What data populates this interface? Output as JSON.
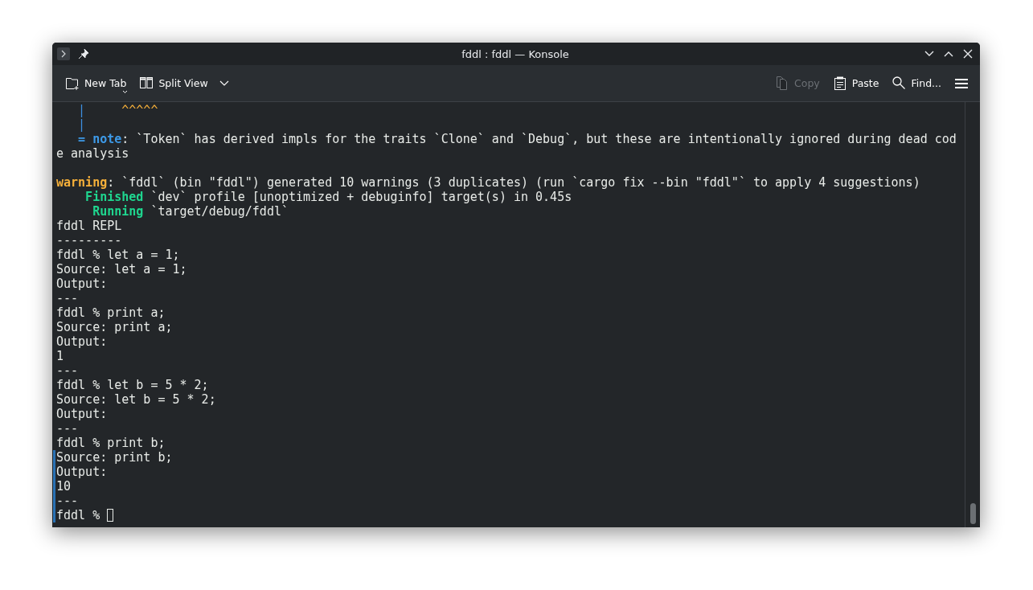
{
  "window": {
    "title": "fddl : fddl — Konsole"
  },
  "toolbar": {
    "left": [
      {
        "label": "New Tab",
        "kind": "newtab",
        "disabled": false
      },
      {
        "label": "Split View",
        "kind": "split",
        "disabled": false
      }
    ],
    "right": [
      {
        "label": "Copy",
        "kind": "copy",
        "disabled": true
      },
      {
        "label": "Paste",
        "kind": "paste",
        "disabled": false
      },
      {
        "label": "Find...",
        "kind": "find",
        "disabled": false
      }
    ]
  },
  "terminal": {
    "lines": [
      {
        "marked": false,
        "segments": [
          {
            "text": "   |",
            "kind": "gutter"
          },
          {
            "text": "     ^^^^^",
            "kind": "caret"
          }
        ]
      },
      {
        "marked": false,
        "segments": [
          {
            "text": "   |",
            "kind": "gutter"
          }
        ]
      },
      {
        "marked": false,
        "segments": [
          {
            "text": "   = note",
            "kind": "note"
          },
          {
            "text": ": `Token` has derived impls for the traits `Clone` and `Debug`, but these are intentionally ignored during dead cod",
            "kind": "plain"
          }
        ]
      },
      {
        "marked": false,
        "segments": [
          {
            "text": "e analysis",
            "kind": "plain"
          }
        ]
      },
      {
        "marked": false
      },
      {
        "marked": false,
        "segments": [
          {
            "text": "warning",
            "kind": "warning"
          },
          {
            "text": ": `fddl` (bin \"fddl\") generated 10 warnings (3 duplicates) (run `cargo fix --bin \"fddl\"` to apply 4 suggestions)",
            "kind": "plain"
          }
        ]
      },
      {
        "marked": false,
        "segments": [
          {
            "text": "    Finished",
            "kind": "status"
          },
          {
            "text": " `dev` profile [unoptimized + debuginfo] target(s) in 0.45s",
            "kind": "plain"
          }
        ]
      },
      {
        "marked": false,
        "segments": [
          {
            "text": "     Running",
            "kind": "status"
          },
          {
            "text": " `target/debug/fddl`",
            "kind": "plain"
          }
        ]
      },
      {
        "marked": false,
        "segments": [
          {
            "text": "fddl REPL",
            "kind": "plain"
          }
        ]
      },
      {
        "marked": false,
        "segments": [
          {
            "text": "---------",
            "kind": "plain"
          }
        ]
      },
      {
        "marked": false,
        "segments": [
          {
            "text": "fddl % let a = 1;",
            "kind": "plain"
          }
        ]
      },
      {
        "marked": false,
        "segments": [
          {
            "text": "Source: let a = 1;",
            "kind": "plain"
          }
        ]
      },
      {
        "marked": false,
        "segments": [
          {
            "text": "Output:",
            "kind": "plain"
          }
        ]
      },
      {
        "marked": false,
        "segments": [
          {
            "text": "---",
            "kind": "plain"
          }
        ]
      },
      {
        "marked": false,
        "segments": [
          {
            "text": "fddl % print a;",
            "kind": "plain"
          }
        ]
      },
      {
        "marked": false,
        "segments": [
          {
            "text": "Source: print a;",
            "kind": "plain"
          }
        ]
      },
      {
        "marked": false,
        "segments": [
          {
            "text": "Output:",
            "kind": "plain"
          }
        ]
      },
      {
        "marked": false,
        "segments": [
          {
            "text": "1",
            "kind": "plain"
          }
        ]
      },
      {
        "marked": false,
        "segments": [
          {
            "text": "---",
            "kind": "plain"
          }
        ]
      },
      {
        "marked": false,
        "segments": [
          {
            "text": "fddl % let b = 5 * 2;",
            "kind": "plain"
          }
        ]
      },
      {
        "marked": false,
        "segments": [
          {
            "text": "Source: let b = 5 * 2;",
            "kind": "plain"
          }
        ]
      },
      {
        "marked": false,
        "segments": [
          {
            "text": "Output:",
            "kind": "plain"
          }
        ]
      },
      {
        "marked": false,
        "segments": [
          {
            "text": "---",
            "kind": "plain"
          }
        ]
      },
      {
        "marked": false,
        "segments": [
          {
            "text": "fddl % print b;",
            "kind": "plain"
          }
        ]
      },
      {
        "marked": true,
        "segments": [
          {
            "text": "Source: print b;",
            "kind": "plain"
          }
        ]
      },
      {
        "marked": true,
        "segments": [
          {
            "text": "Output:",
            "kind": "plain"
          }
        ]
      },
      {
        "marked": true,
        "segments": [
          {
            "text": "10",
            "kind": "plain"
          }
        ]
      },
      {
        "marked": true,
        "segments": [
          {
            "text": "---",
            "kind": "plain"
          }
        ]
      },
      {
        "marked": true,
        "cursor": true,
        "segments": [
          {
            "text": "fddl % ",
            "kind": "plain"
          }
        ]
      }
    ]
  }
}
